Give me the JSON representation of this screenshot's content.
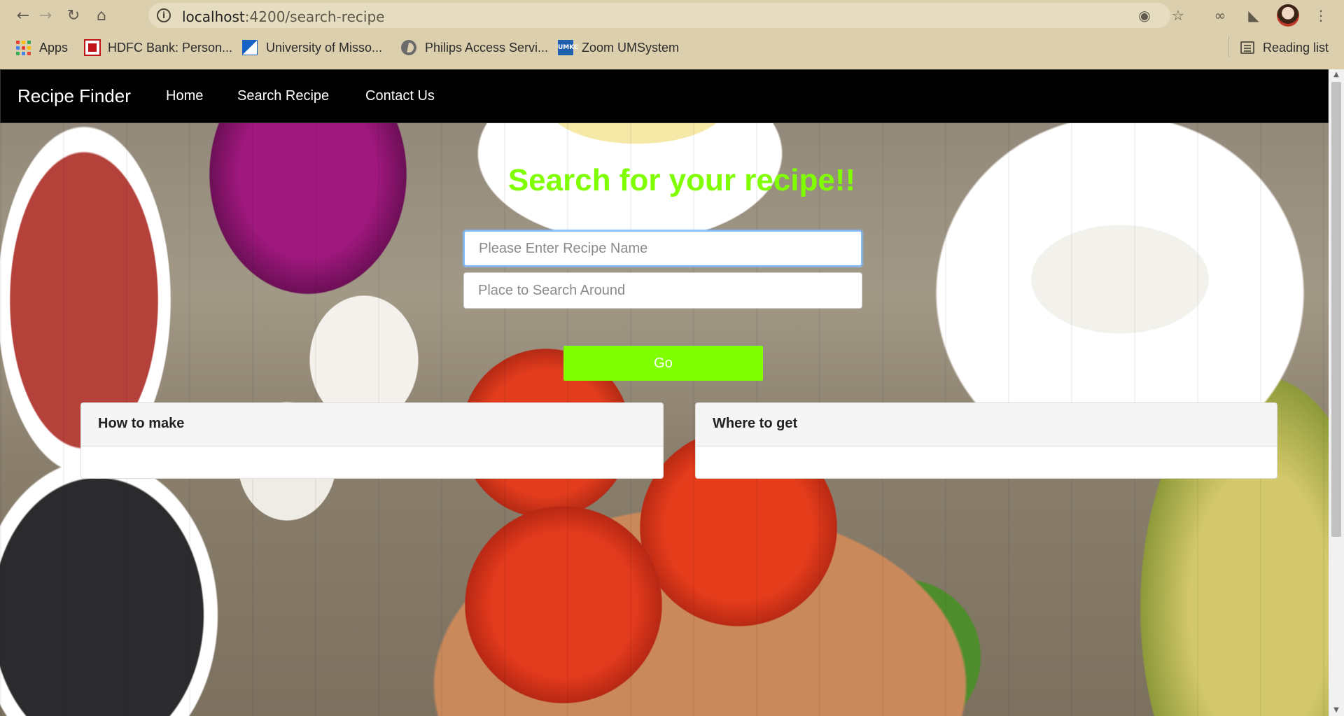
{
  "browser": {
    "url_host": "localhost",
    "url_path": ":4200/search-recipe",
    "icons": {
      "back": "arrow-left-icon",
      "forward": "arrow-right-icon",
      "reload": "reload-icon",
      "home": "home-icon",
      "info": "info-icon",
      "tracking": "tracking-blocked-icon",
      "star": "star-icon",
      "extension1": "extension-icon",
      "extensions": "puzzle-icon",
      "menu": "kebab-menu-icon"
    },
    "info_glyph": "i",
    "bookmarks": [
      {
        "label": "Apps"
      },
      {
        "label": "HDFC Bank: Person..."
      },
      {
        "label": "University of Misso..."
      },
      {
        "label": "Philips Access Servi..."
      },
      {
        "label": "Zoom UMSystem"
      }
    ],
    "umkc_text": "UMKC",
    "reading_list": "Reading list"
  },
  "navbar": {
    "brand": "Recipe Finder",
    "links": [
      "Home",
      "Search Recipe",
      "Contact Us"
    ]
  },
  "search": {
    "title": "Search for your recipe!!",
    "recipe_placeholder": "Please Enter Recipe Name",
    "place_placeholder": "Place to Search Around",
    "go_label": "Go"
  },
  "cards": {
    "how_to_make": "How to make",
    "where_to_get": "Where to get"
  },
  "colors": {
    "accent_green": "#7fff00",
    "navbar_bg": "#000000"
  }
}
